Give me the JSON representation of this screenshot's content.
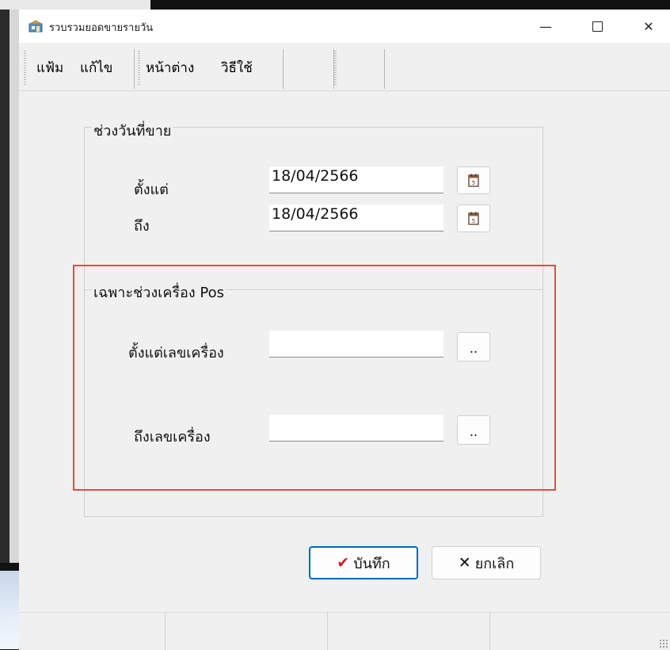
{
  "window": {
    "title": "รวบรวมยอดขายรายวัน",
    "controls": {
      "minimize": "—",
      "maximize": "",
      "close": "✕"
    }
  },
  "menu": {
    "group1": [
      "แฟ้ม",
      "แก้ไข"
    ],
    "group2": [
      "หน้าต่าง",
      "วิธีใช้"
    ]
  },
  "date_range": {
    "title": "ช่วงวันที่ขาย",
    "from_label": "ตั้งแต่",
    "from_value": "18/04/2566",
    "to_label": "ถึง",
    "to_value": "18/04/2566"
  },
  "pos_range": {
    "title": "เฉพาะช่วงเครื่อง Pos",
    "from_label": "ตั้งแต่เลขเครื่อง",
    "from_value": "",
    "to_label": "ถึงเลขเครื่อง",
    "to_value": "",
    "browse_label": ".."
  },
  "buttons": {
    "save_icon": "✔",
    "save_label": "บันทึก",
    "cancel_icon": "✕",
    "cancel_label": "ยกเลิก"
  },
  "colors": {
    "highlight": "#e24a4a",
    "default_button_border": "#0067c0",
    "check": "#d11f1f"
  },
  "icons": [
    "app-icon",
    "calendar-icon",
    "check-icon",
    "cancel-x-icon"
  ]
}
